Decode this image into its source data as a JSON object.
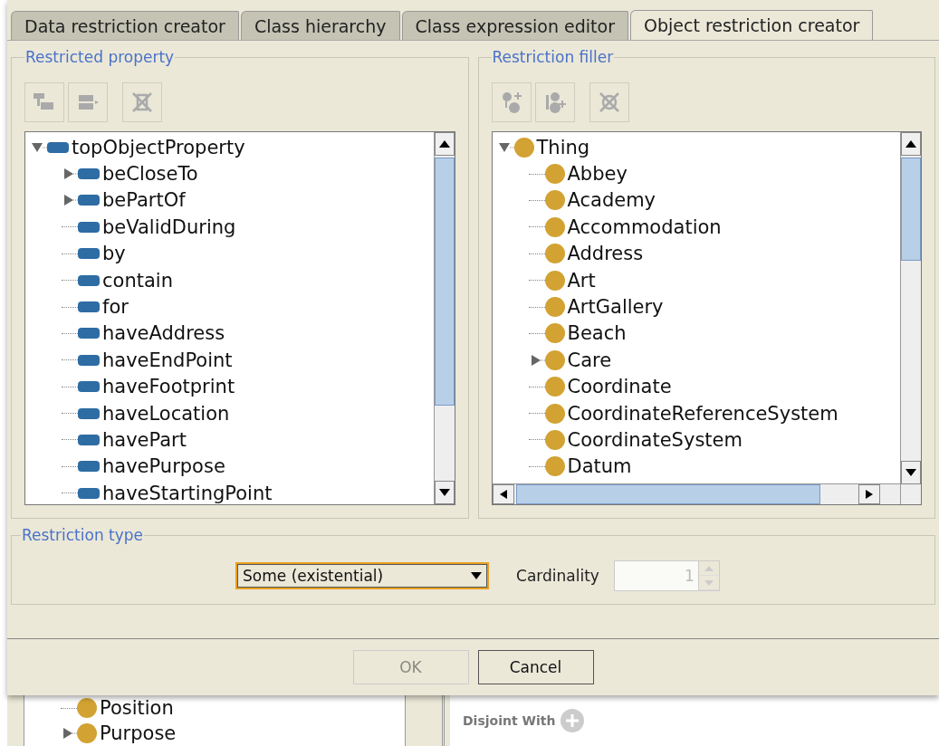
{
  "tabs": [
    {
      "label": "Data restriction creator",
      "selected": false
    },
    {
      "label": "Class hierarchy",
      "selected": false
    },
    {
      "label": "Class expression editor",
      "selected": false
    },
    {
      "label": "Object restriction creator",
      "selected": true
    }
  ],
  "property_panel": {
    "title": "Restricted property",
    "root": {
      "label": "topObjectProperty",
      "expanded": true
    },
    "items": [
      {
        "label": "beCloseTo",
        "has_children": true
      },
      {
        "label": "bePartOf",
        "has_children": true
      },
      {
        "label": "beValidDuring",
        "has_children": false
      },
      {
        "label": "by",
        "has_children": false
      },
      {
        "label": "contain",
        "has_children": false
      },
      {
        "label": "for",
        "has_children": false
      },
      {
        "label": "haveAddress",
        "has_children": false
      },
      {
        "label": "haveEndPoint",
        "has_children": false
      },
      {
        "label": "haveFootprint",
        "has_children": false
      },
      {
        "label": "haveLocation",
        "has_children": false
      },
      {
        "label": "havePart",
        "has_children": false
      },
      {
        "label": "havePurpose",
        "has_children": false
      },
      {
        "label": "haveStartingPoint",
        "has_children": false
      }
    ]
  },
  "filler_panel": {
    "title": "Restriction filler",
    "root": {
      "label": "Thing",
      "expanded": true
    },
    "items": [
      {
        "label": "Abbey",
        "has_children": false
      },
      {
        "label": "Academy",
        "has_children": false
      },
      {
        "label": "Accommodation",
        "has_children": false
      },
      {
        "label": "Address",
        "has_children": false
      },
      {
        "label": "Art",
        "has_children": false
      },
      {
        "label": "ArtGallery",
        "has_children": false
      },
      {
        "label": "Beach",
        "has_children": false
      },
      {
        "label": "Care",
        "has_children": true
      },
      {
        "label": "Coordinate",
        "has_children": false
      },
      {
        "label": "CoordinateReferenceSystem",
        "has_children": false
      },
      {
        "label": "CoordinateSystem",
        "has_children": false
      },
      {
        "label": "Datum",
        "has_children": false
      }
    ]
  },
  "restriction_type": {
    "title": "Restriction type",
    "value": "Some (existential)",
    "cardinality_label": "Cardinality",
    "cardinality": "1",
    "cardinality_disabled": true
  },
  "buttons": [
    {
      "label": "OK",
      "disabled": true
    },
    {
      "label": "Cancel",
      "disabled": false
    }
  ],
  "background": {
    "items": [
      {
        "label": "Position",
        "has_children": false
      },
      {
        "label": "Purpose",
        "has_children": true
      }
    ],
    "disjoint_label": "Disjoint With"
  }
}
